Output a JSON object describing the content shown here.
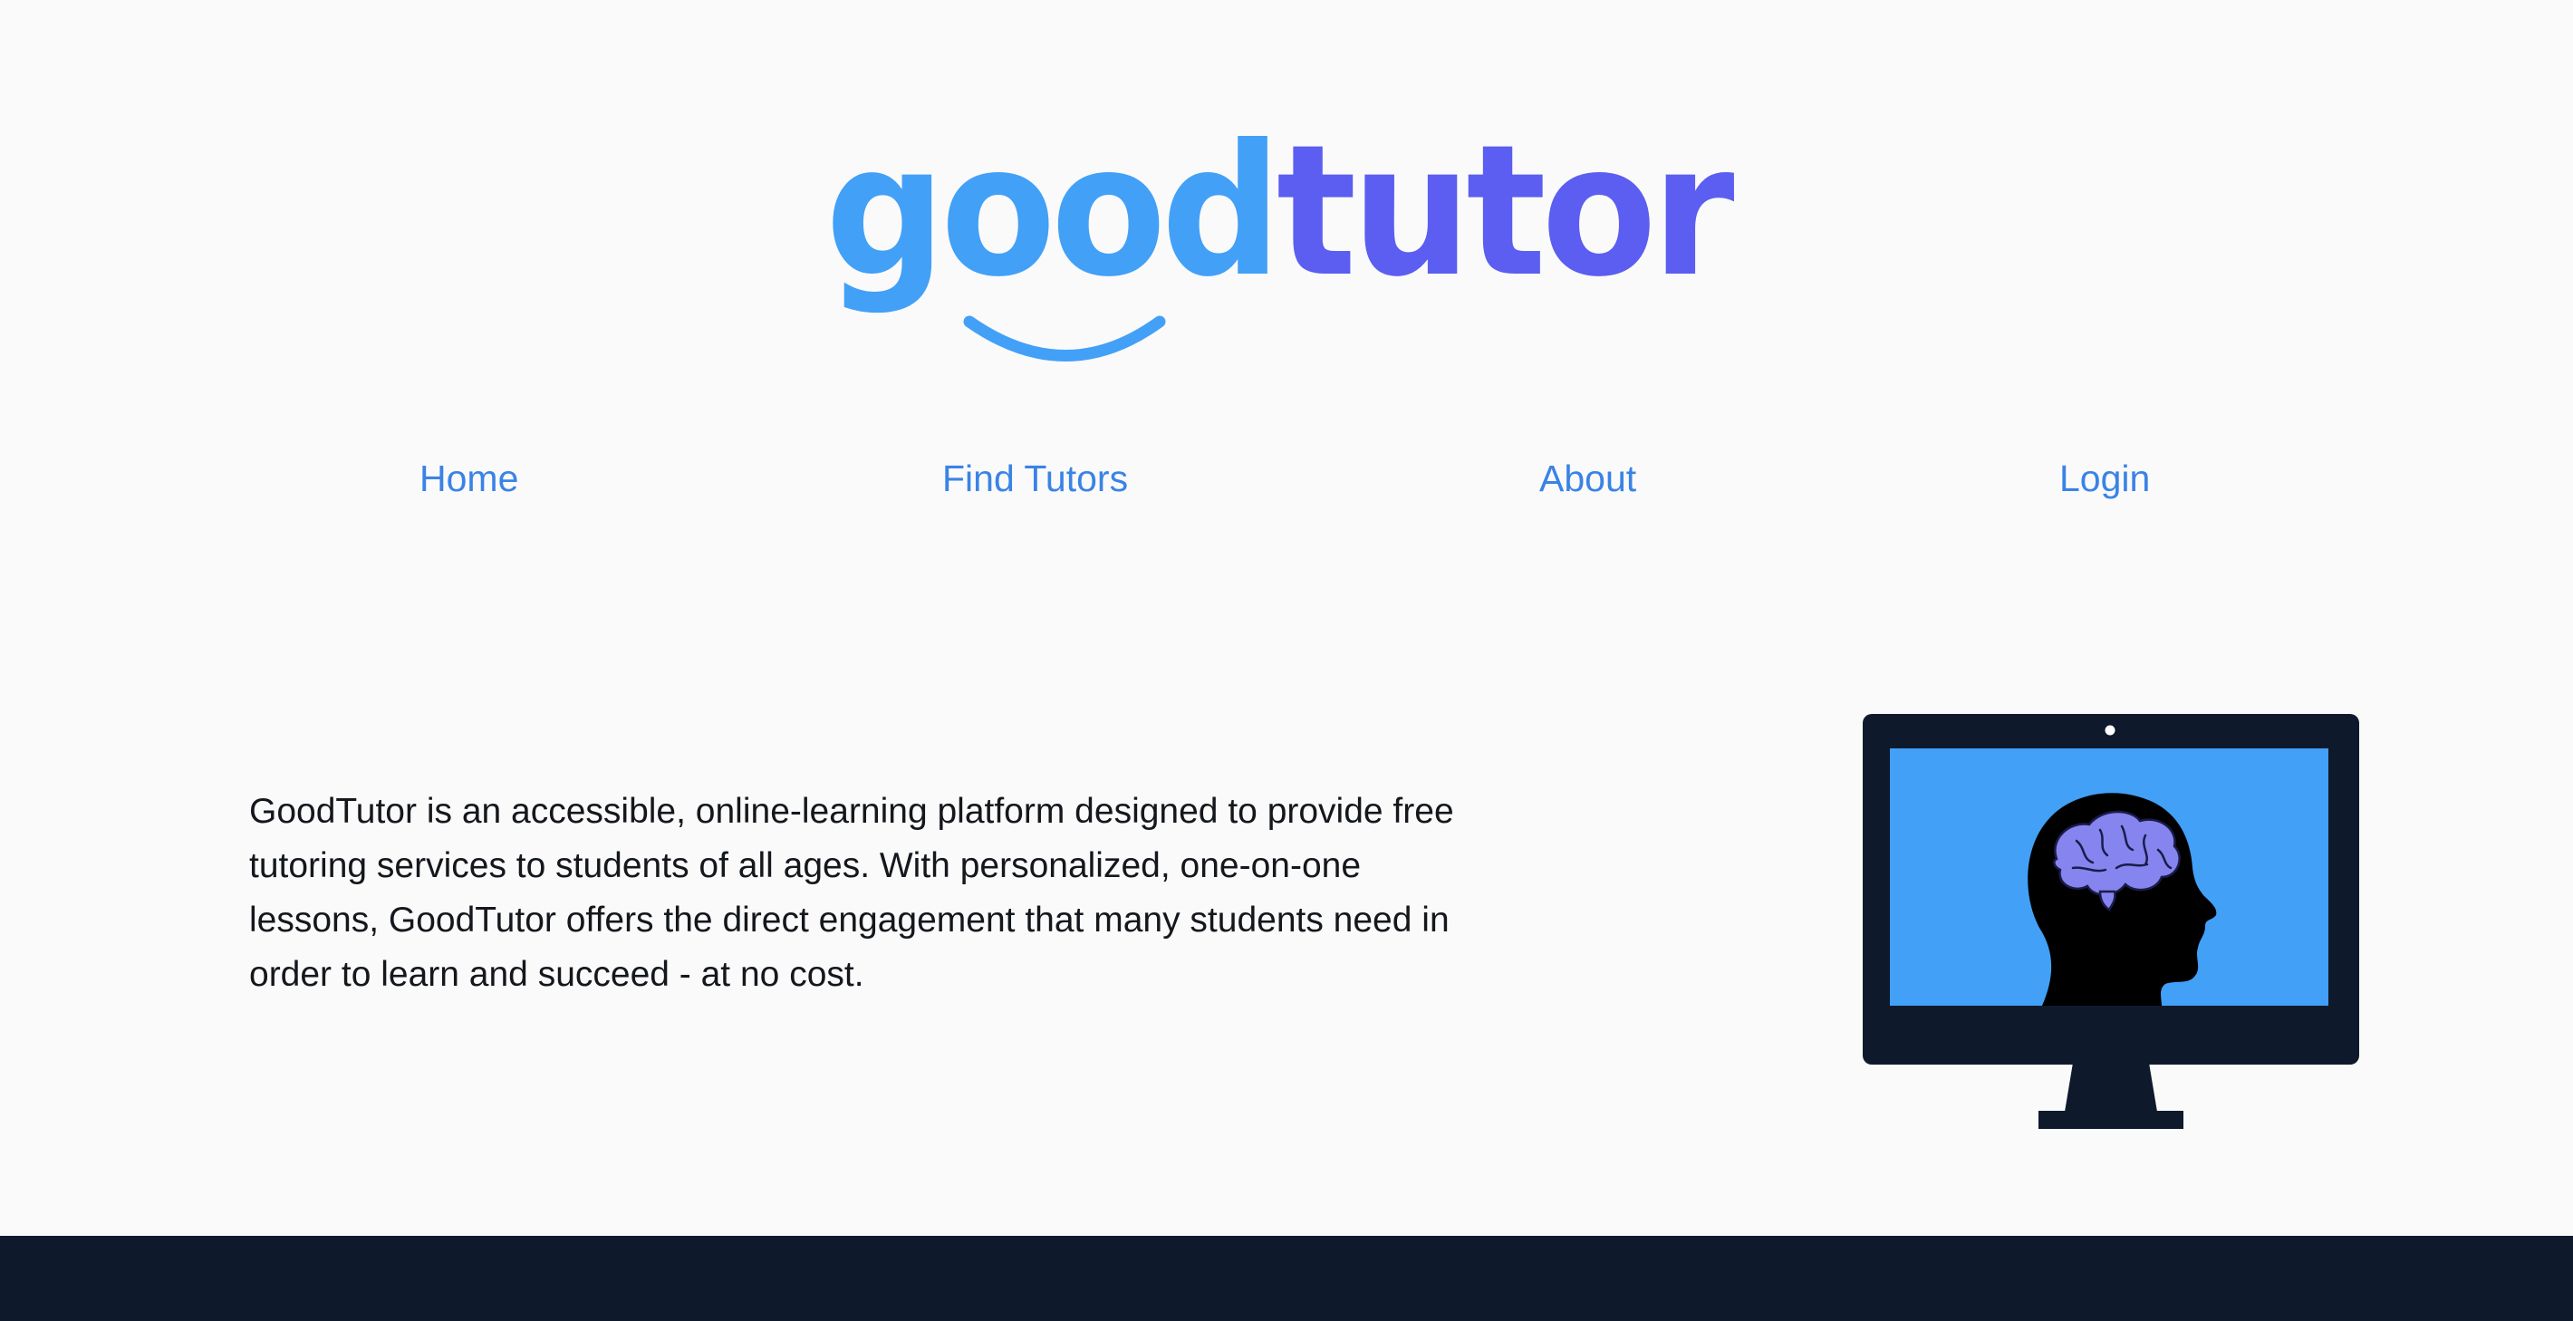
{
  "brand": {
    "name_part_1": "good",
    "name_part_2": "tutor",
    "color_primary": "#42a0f7",
    "color_secondary": "#5b5ef0"
  },
  "nav": {
    "items": [
      {
        "label": "Home"
      },
      {
        "label": "Find Tutors"
      },
      {
        "label": "About"
      },
      {
        "label": "Login"
      }
    ],
    "link_color": "#3a83e6"
  },
  "intro": {
    "text": "GoodTutor is an accessible, online-learning platform designed to provide free tutoring services to students of all ages. With personalized, one-on-one lessons, GoodTutor offers the direct engagement that many students need in order to learn and succeed - at no cost."
  },
  "illustration": {
    "icon": "monitor-with-brain-icon",
    "screen_color": "#42a0f7",
    "frame_color": "#0e1a2c",
    "brain_color": "#8684ee"
  },
  "footer": {
    "color": "#0e1a2c"
  }
}
